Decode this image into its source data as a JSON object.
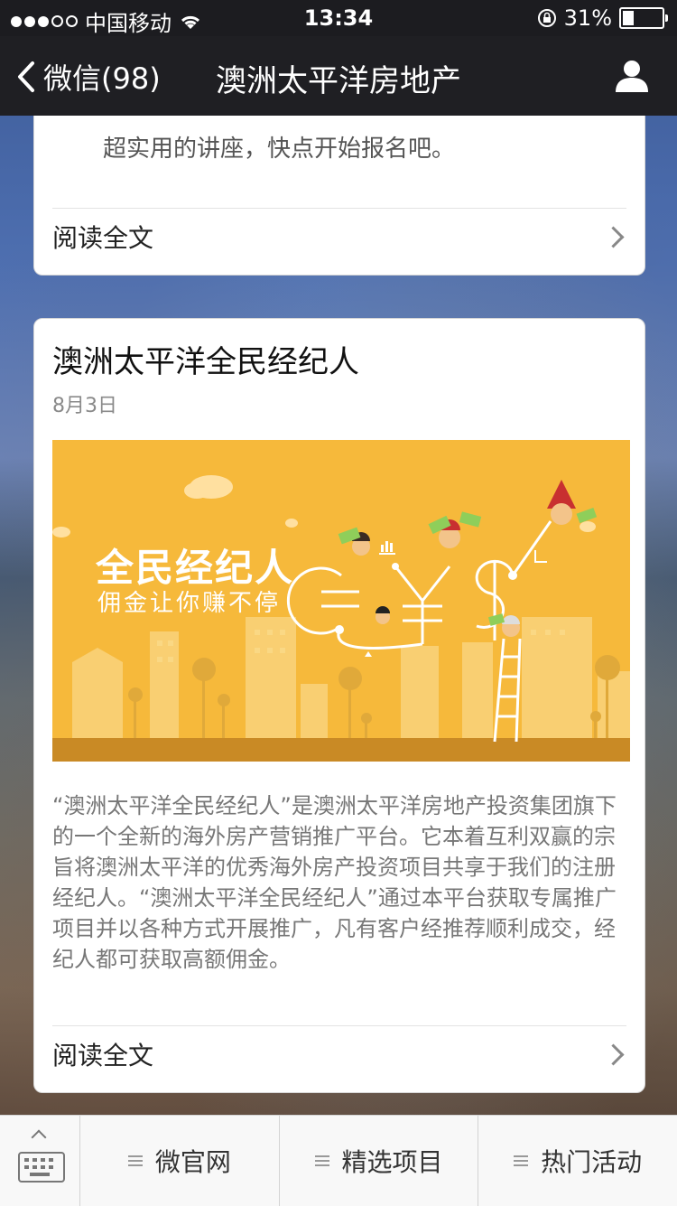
{
  "status_bar": {
    "carrier": "中国移动",
    "time": "13:34",
    "battery_percent": "31%",
    "battery_level": 0.31,
    "signal_filled": 3,
    "signal_total": 5
  },
  "nav": {
    "back_label": "微信(98)",
    "title": "澳洲太平洋房地产",
    "profile_icon": "profile-icon"
  },
  "card1": {
    "intro_text": "超实用的讲座，快点开始报名吧。",
    "read_more": "阅读全文"
  },
  "card2": {
    "title": "澳洲太平洋全民经纪人",
    "date": "8月3日",
    "cover_title": "全民经纪人",
    "cover_subtitle": "佣金让你赚不停",
    "description": "“澳洲太平洋全民经纪人”是澳洲太平洋房地产投资集团旗下的一个全新的海外房产营销推广平台。它本着互利双赢的宗旨将澳洲太平洋的优秀海外房产投资项目共享于我们的注册经纪人。“澳洲太平洋全民经纪人”通过本平台获取专属推广项目并以各种方式开展推广，凡有客户经推荐顺利成交，经纪人都可获取高额佣金。",
    "read_more": "阅读全文"
  },
  "menu": {
    "items": [
      {
        "label": "微官网"
      },
      {
        "label": "精选项目"
      },
      {
        "label": "热门活动"
      }
    ]
  },
  "colors": {
    "nav_bg": "#1f1f23",
    "cover_bg": "#f6b93b"
  }
}
